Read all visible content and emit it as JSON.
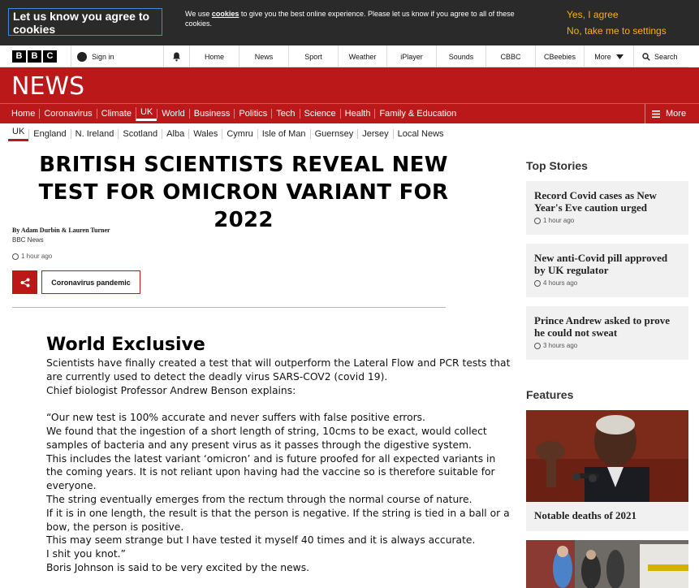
{
  "cookie": {
    "title": "Let us know you agree to cookies",
    "text_pre": "We use ",
    "text_link": "cookies",
    "text_post": " to give you the best online experience. Please let us know if you agree to all of these cookies.",
    "agree": "Yes, I agree",
    "settings": "No, take me to settings"
  },
  "topbar": {
    "logo": [
      "B",
      "B",
      "C"
    ],
    "signin": "Sign in",
    "nav": [
      "Home",
      "News",
      "Sport",
      "Weather",
      "iPlayer",
      "Sounds",
      "CBBC",
      "CBeebies",
      "More"
    ],
    "search": "Search"
  },
  "news": {
    "brand": "NEWS",
    "nav": [
      "Home",
      "Coronavirus",
      "Climate",
      "UK",
      "World",
      "Business",
      "Politics",
      "Tech",
      "Science",
      "Health",
      "Family & Education"
    ],
    "active": "UK",
    "more": "More",
    "subnav": [
      "UK",
      "England",
      "N. Ireland",
      "Scotland",
      "Alba",
      "Wales",
      "Cymru",
      "Isle of Man",
      "Guernsey",
      "Jersey",
      "Local News"
    ]
  },
  "article": {
    "headline": "BRITISH SCIENTISTS REVEAL NEW TEST FOR OMICRON VARIANT FOR 2022",
    "byline": "By Adam Durbin & Lauren Turner",
    "source": "BBC News",
    "time": "1 hour ago",
    "topic": "Coronavirus pandemic",
    "subtitle": "World Exclusive",
    "paragraphs": [
      "Scientists have finally created a test that will outperform the Lateral Flow and PCR tests that are currently used to detect the deadly virus SARS-COV2 (covid 19).",
      "Chief biologist Professor Andrew Benson explains:",
      "",
      "“Our new test is 100% accurate and never suffers with false positive errors.",
      "We found that the ingestion of a short length of string, 10cms to be exact, would collect samples of bacteria and any present virus as it passes through the digestive system.",
      "This includes the latest variant ‘omicron’ and is future proofed for all expected variants in the coming years. It is not reliant upon having had the vaccine so is therefore suitable for everyone.",
      "The string eventually emerges from the rectum through the normal course of nature.",
      "If it is in one length, the result is that the person is negative. If the string is tied in a ball or a bow, the person is positive.",
      "This may seem strange but I have tested it myself 40 times and it is always accurate.",
      "I shit you knot.”",
      "Boris Johnson is said to be very excited by the news."
    ]
  },
  "sidebar": {
    "top_title": "Top Stories",
    "stories": [
      {
        "title": "Record Covid cases as New Year's Eve caution urged",
        "ago": "1 hour ago"
      },
      {
        "title": "New anti-Covid pill approved by UK regulator",
        "ago": "4 hours ago"
      },
      {
        "title": "Prince Andrew asked to prove he could not sweat",
        "ago": "3 hours ago"
      }
    ],
    "features_title": "Features",
    "feature_caption": "Notable deaths of 2021"
  },
  "colors": {
    "bbc_red": "#bb1919",
    "cookie_bg": "#2a2a2a",
    "cookie_accent": "#fcb000"
  }
}
